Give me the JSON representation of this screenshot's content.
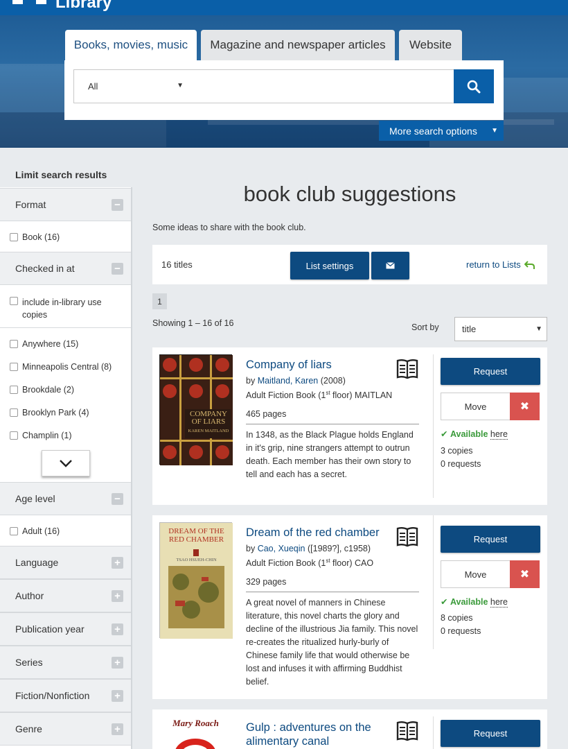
{
  "header": {
    "logo_text": "Library"
  },
  "search": {
    "tabs": [
      {
        "label": "Books, movies, music"
      },
      {
        "label": "Magazine and newspaper articles"
      },
      {
        "label": "Website"
      }
    ],
    "scope_value": "All",
    "query": "",
    "more_options_label": "More search options"
  },
  "sidebar": {
    "title": "Limit search results",
    "format": {
      "label": "Format",
      "options": [
        "Book (16)"
      ]
    },
    "checked_in": {
      "label": "Checked in at",
      "include_label": "include in-library use copies",
      "options": [
        "Anywhere (15)",
        "Minneapolis Central (8)",
        "Brookdale (2)",
        "Brooklyn Park (4)",
        "Champlin (1)"
      ]
    },
    "age_level": {
      "label": "Age level",
      "options": [
        "Adult (16)"
      ]
    },
    "collapsed_facets": [
      "Language",
      "Author",
      "Publication year",
      "Series",
      "Fiction/Nonfiction",
      "Genre"
    ]
  },
  "main": {
    "title": "book club suggestions",
    "description": "Some ideas to share with the book club.",
    "count": "16 titles",
    "list_settings_label": "List settings",
    "return_label": "return to Lists",
    "page": "1",
    "showing": "Showing 1 – 16 of 16",
    "sort_label": "Sort by",
    "sort_value": "title"
  },
  "books": [
    {
      "title": "Company of liars",
      "by": "by",
      "author": "Maitland, Karen",
      "year": "(2008)",
      "location_prefix": "Adult Fiction Book (1",
      "location_sup": "st",
      "location_suffix": " floor) MAITLAN",
      "pages": "465 pages",
      "summary": "In 1348, as the Black Plague holds England in it's grip, nine strangers attempt to outrun death. Each member has their own story to tell and each has a secret.",
      "request_label": "Request",
      "move_label": "Move",
      "available": "Available",
      "here": "here",
      "copies": "3 copies",
      "requests": "0 requests",
      "cover_title": "COMPANY OF LIARS",
      "cover_author": "KAREN MAITLAND"
    },
    {
      "title": "Dream of the red chamber",
      "by": "by",
      "author": "Cao, Xueqin",
      "year": "([1989?], c1958)",
      "location_prefix": "Adult Fiction Book (1",
      "location_sup": "st",
      "location_suffix": " floor) CAO",
      "pages": "329 pages",
      "summary": "A great novel of manners in Chinese literature, this novel charts the glory and decline of the illustrious Jia family. This novel re-creates the ritualized hurly-burly of Chinese family life that would otherwise be lost and infuses it with affirming Buddhist belief.",
      "request_label": "Request",
      "move_label": "Move",
      "available": "Available",
      "here": "here",
      "copies": "8 copies",
      "requests": "0 requests",
      "cover_title": "DREAM OF THE RED CHAMBER",
      "cover_author": "TSAO HSUEH-CHIN"
    },
    {
      "title": "Gulp : adventures on the alimentary canal",
      "request_label": "Request",
      "cover_author": "Mary Roach"
    }
  ],
  "colors": {
    "brand_blue": "#0a5fa8",
    "button_navy": "#0d4a80",
    "danger": "#d9534f",
    "success": "#3a9a3a"
  }
}
